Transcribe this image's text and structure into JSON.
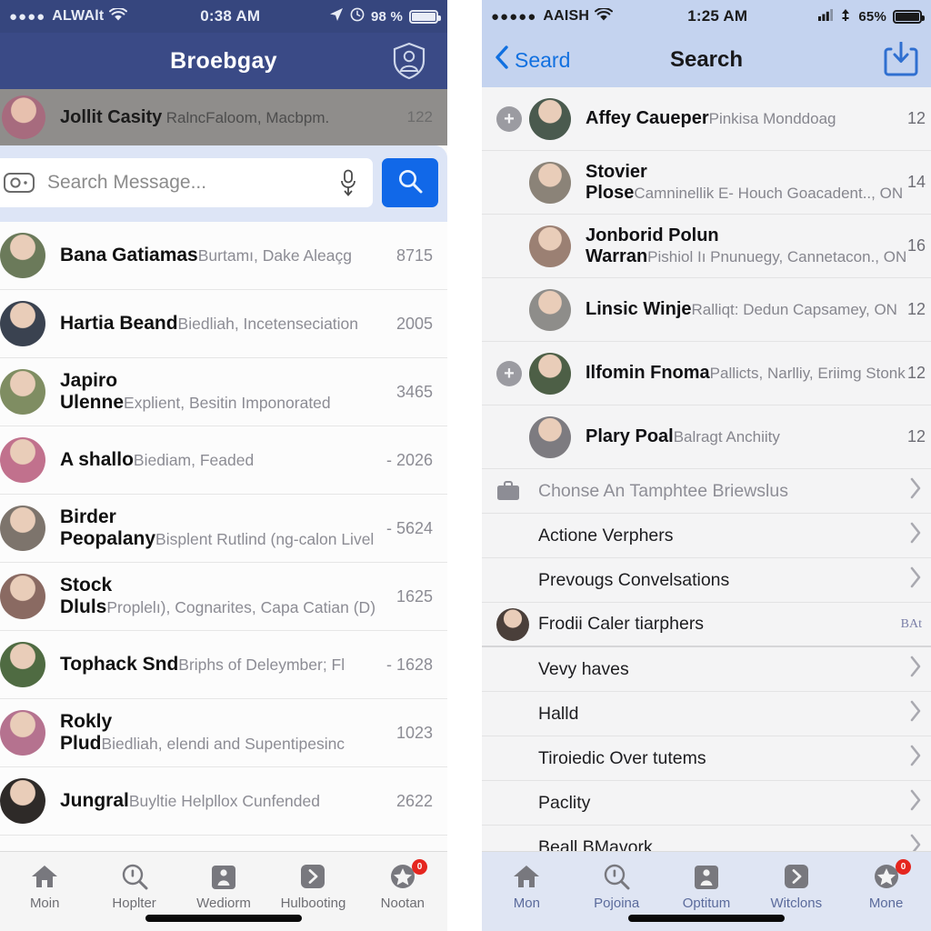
{
  "left_phone": {
    "status_bar": {
      "signal_dots": "●●●●",
      "carrier": "ALWAlt",
      "wifi_icon": "wifi-icon",
      "time": "0:38 AM",
      "location_icon": "location-arrow-icon",
      "alarm_icon": "alarm-clock-icon",
      "battery_percent": "98 %",
      "battery_icon": "battery-icon"
    },
    "nav_bar": {
      "title": "Broebgay",
      "right_icon": "shield-person-badge-icon"
    },
    "selected_row": {
      "name": "Jollit Casity",
      "subtitle": "RalncFaloom, Macbpm.",
      "count": "122",
      "avatar": "avatar-jollit-casity",
      "avatar_color": "#a76b7e"
    },
    "search": {
      "camera_icon": "camera-icon",
      "placeholder": "Search Message...",
      "value": "",
      "mic_icon": "microphone-icon",
      "go_icon": "search-icon",
      "go_color": "#1168e8"
    },
    "conversations": [
      {
        "name": "Bana Gatiamas",
        "subtitle": "Burtamı, Dake Aleaçg",
        "count": "8715",
        "avatar": "avatar-bana-gatiamas",
        "avatar_color": "#6b7a5a"
      },
      {
        "name": "Hartia Beand",
        "subtitle": "Biedliah, Incetenseciation",
        "count": "2005",
        "avatar": "avatar-hartia-beand",
        "avatar_color": "#3a4250"
      },
      {
        "name": "Japiro Ulenne",
        "subtitle": "Explient, Besitin Imponorated",
        "count": "3465",
        "avatar": "avatar-japiro-ulenne",
        "avatar_color": "#7f8d62"
      },
      {
        "name": "A shallo",
        "subtitle": "Biediam, Feaded",
        "count": "- 2026",
        "avatar": "avatar-a-shallo",
        "avatar_color": "#c1718d"
      },
      {
        "name": "Birder Peopalany",
        "subtitle": "Bisplent Rutlind (ng-calon Livel",
        "count": "- 5624",
        "avatar": "avatar-birder-peopalany",
        "avatar_color": "#7d746c"
      },
      {
        "name": "Stock Dluls",
        "subtitle": "Proplelı), Cognarites, Capa Catian (D)",
        "count": "1625",
        "avatar": "avatar-stock-dluls",
        "avatar_color": "#8a6a62"
      },
      {
        "name": "Tophack Snd",
        "subtitle": "Briphs of Deleymber; Fl",
        "count": "- 1628",
        "avatar": "avatar-tophack-snd",
        "avatar_color": "#4f6b42"
      },
      {
        "name": "Rokly Plud",
        "subtitle": "Biedliah, elendi and Supentipesinc",
        "count": "1023",
        "avatar": "avatar-rokly-plud",
        "avatar_color": "#b5728f"
      },
      {
        "name": "Jungral",
        "subtitle": "Buyltie Helpllox Cunfended",
        "count": "2622",
        "avatar": "avatar-jungral",
        "avatar_color": "#2e2a28"
      }
    ],
    "tab_bar": [
      {
        "label": "Moin",
        "icon": "home-icon",
        "badge": ""
      },
      {
        "label": "Hoplter",
        "icon": "search-icon",
        "badge": ""
      },
      {
        "label": "Wediorm",
        "icon": "people-icon",
        "badge": ""
      },
      {
        "label": "Hulbooting",
        "icon": "chevron-right-icon",
        "badge": ""
      },
      {
        "label": "Nootan",
        "icon": "star-icon",
        "badge": "0"
      }
    ]
  },
  "right_phone": {
    "status_bar": {
      "signal_dots": "●●●●●",
      "carrier": "AAISH",
      "wifi_icon": "wifi-icon",
      "time": "1:25 AM",
      "bars_icon": "signal-bars-icon",
      "updown_icon": "transfer-icon",
      "battery_percent": "65%",
      "battery_icon": "battery-icon"
    },
    "nav_bar": {
      "back_icon": "chevron-left-icon",
      "back_label": "Seard",
      "title": "Search",
      "right_icon": "download-icon",
      "accent_color": "#1170e0"
    },
    "results": [
      {
        "name": "Affey Caueper",
        "subtitle": "Pinkisa Monddoag",
        "count": "12",
        "has_plus": true,
        "avatar": "avatar-affey-caueper",
        "avatar_color": "#4a5a4e"
      },
      {
        "name": "Stovier Plose",
        "subtitle": "Camninellik E- Houch Goacadent.., ON",
        "count": "14",
        "has_plus": false,
        "avatar": "avatar-stovier-plose",
        "avatar_color": "#8b8378"
      },
      {
        "name": "Jonborid Polun Warran",
        "subtitle": "Pishiol Iı Pnunuegy, Cannetacon., ON",
        "count": "16",
        "has_plus": false,
        "avatar": "avatar-jonborid-polun-warran",
        "avatar_color": "#9b8073"
      },
      {
        "name": "Linsic Winje",
        "subtitle": "Ralliqt: Dedun Capsamey, ON",
        "count": "12",
        "has_plus": false,
        "avatar": "avatar-linsic-winje",
        "avatar_color": "#8e8d8a"
      },
      {
        "name": "Ilfomin Fnoma",
        "subtitle": "Pallicts, Narlliy, Eriimg Stonk",
        "count": "12",
        "has_plus": true,
        "avatar": "avatar-ilfomin-fnoma",
        "avatar_color": "#4d5f46"
      },
      {
        "name": "Plary Poal",
        "subtitle": "Balragt Anchiity",
        "count": "12",
        "has_plus": false,
        "avatar": "avatar-plary-poal",
        "avatar_color": "#7d7b80"
      }
    ],
    "menu": [
      {
        "label": "Chonse An Tamphtee Briewslus",
        "lead": "briefcase-icon",
        "muted": true,
        "accessory": "chevron-right-icon",
        "thick": false
      },
      {
        "label": "Actione Verphers",
        "lead": "",
        "muted": false,
        "accessory": "chevron-right-icon",
        "thick": false
      },
      {
        "label": "Prevougs Convelsations",
        "lead": "",
        "muted": false,
        "accessory": "chevron-right-icon",
        "thick": false
      },
      {
        "label": "Frodii Caler tiarphers",
        "lead": "avatar-frodii-caler",
        "muted": false,
        "accessory": "BAt",
        "thick": true
      },
      {
        "label": "Vevy haves",
        "lead": "",
        "muted": false,
        "accessory": "chevron-right-icon",
        "thick": false
      },
      {
        "label": "Halld",
        "lead": "",
        "muted": false,
        "accessory": "chevron-right-icon",
        "thick": false
      },
      {
        "label": "Tiroiedic Over tutems",
        "lead": "",
        "muted": false,
        "accessory": "chevron-right-icon",
        "thick": false
      },
      {
        "label": "Paclity",
        "lead": "",
        "muted": false,
        "accessory": "chevron-right-icon",
        "thick": false
      },
      {
        "label": "Beall BMavork",
        "lead": "",
        "muted": false,
        "accessory": "chevron-right-icon",
        "thick": false
      }
    ],
    "tab_bar": [
      {
        "label": "Mon",
        "icon": "home-icon",
        "badge": ""
      },
      {
        "label": "Pojoina",
        "icon": "search-icon",
        "badge": ""
      },
      {
        "label": "Optitum",
        "icon": "people-icon",
        "badge": ""
      },
      {
        "label": "Witclons",
        "icon": "chevron-right-icon",
        "badge": ""
      },
      {
        "label": "Mone",
        "icon": "star-icon",
        "badge": "0"
      }
    ]
  }
}
